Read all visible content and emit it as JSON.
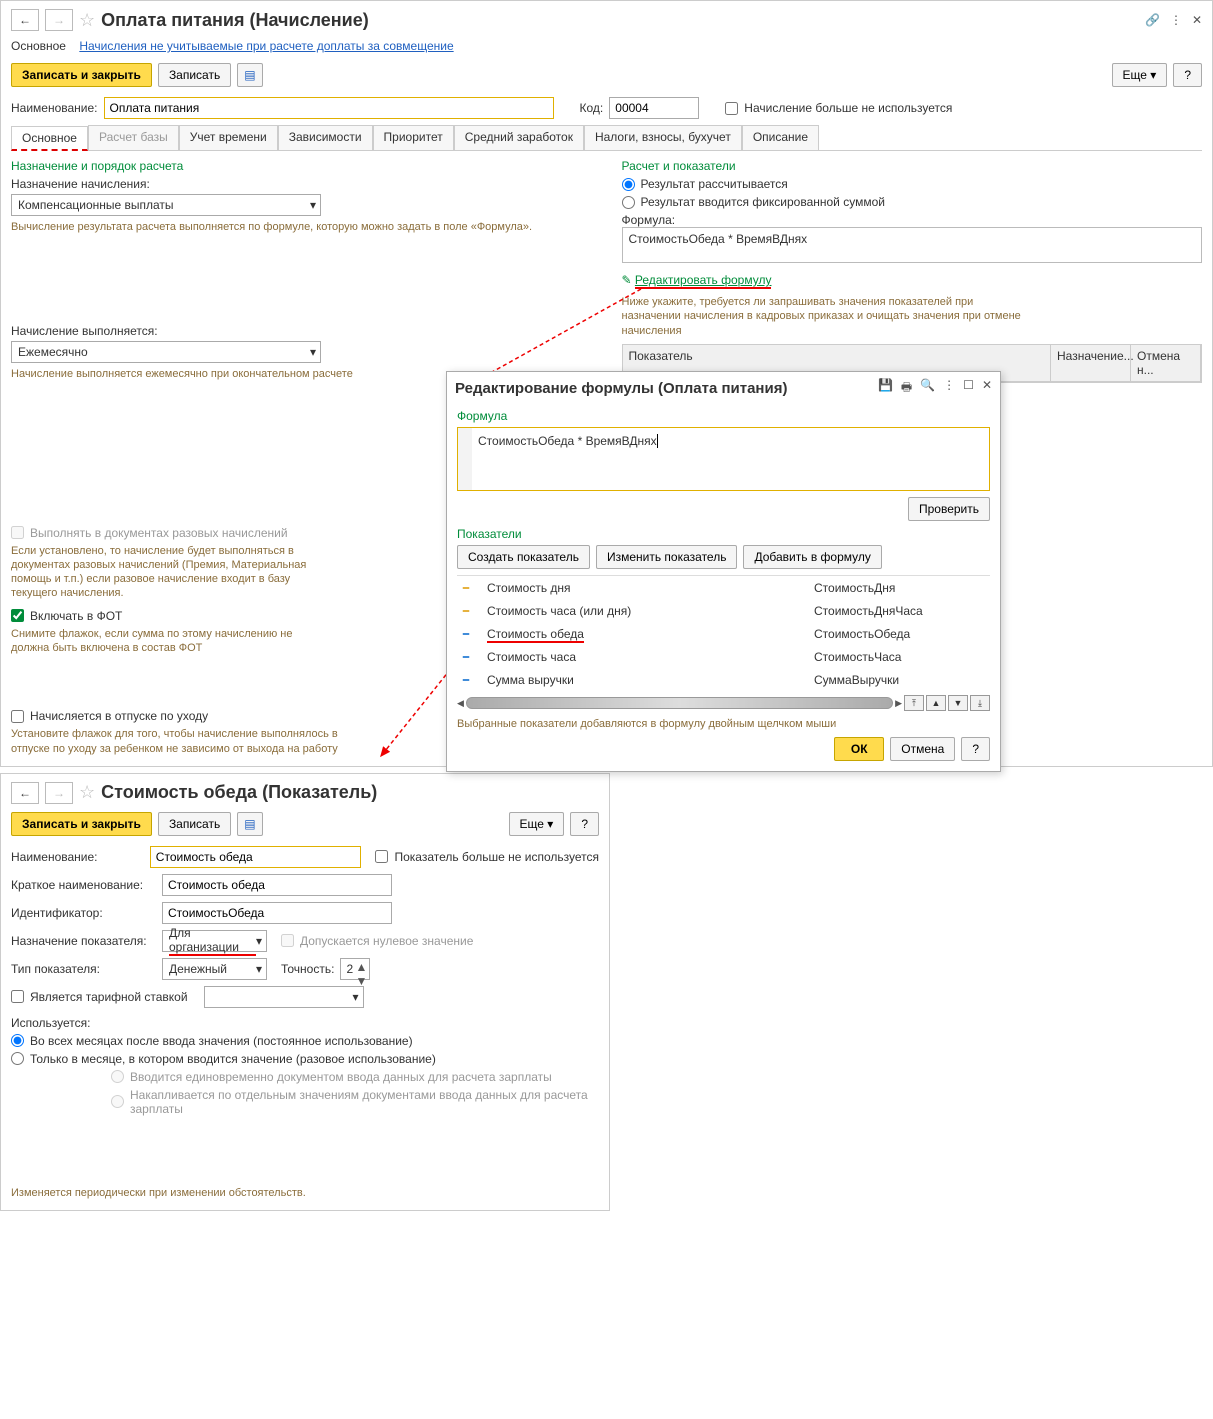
{
  "accrual": {
    "title": "Оплата питания (Начисление)",
    "nav_main": "Основное",
    "nav_link": "Начисления не учитываемые при расчете доплаты за совмещение",
    "btn_save_close": "Записать и закрыть",
    "btn_save": "Записать",
    "btn_more": "Еще",
    "name_label": "Наименование:",
    "name_value": "Оплата питания",
    "code_label": "Код:",
    "code_value": "00004",
    "not_used_label": "Начисление больше не используется",
    "tabs": [
      "Основное",
      "Расчет базы",
      "Учет времени",
      "Зависимости",
      "Приоритет",
      "Средний заработок",
      "Налоги, взносы, бухучет",
      "Описание"
    ],
    "left": {
      "sec1": "Назначение и порядок расчета",
      "purpose_label": "Назначение начисления:",
      "purpose_value": "Компенсационные выплаты",
      "hint_formula": "Вычисление результата расчета выполняется по формуле, которую можно задать в поле «Формула».",
      "exec_label": "Начисление выполняется:",
      "exec_value": "Ежемесячно",
      "hint_monthly": "Начисление выполняется ежемесячно при окончательном расчете",
      "once_check": "Выполнять в документах разовых начислений",
      "hint_once": "Если установлено, то начисление будет выполняться в документах разовых начислений (Премия, Материальная помощь и т.п.) если разовое начисление входит в базу текущего начисления.",
      "fot_check": "Включать в ФОТ",
      "hint_fot": "Снимите флажок, если сумма по этому начислению не должна быть включена в состав ФОТ",
      "leave_check": "Начисляется в отпуске по уходу",
      "hint_leave": "Установите флажок для того, чтобы начисление выполнялось в отпуске по уходу за ребенком не зависимо от выхода на работу"
    },
    "right": {
      "sec1": "Расчет и показатели",
      "r1": "Результат рассчитывается",
      "r2": "Результат вводится фиксированной суммой",
      "formula_label": "Формула:",
      "formula_value": "СтоимостьОбеда * ВремяВДнях",
      "edit_link": "Редактировать формулу",
      "hint_below": "Ниже укажите, требуется ли запрашивать значения показателей при назначении начисления в кадровых приказах и очищать значения при отмене начисления",
      "th1": "Показатель",
      "th2": "Назначение...",
      "th3": "Отмена н..."
    }
  },
  "editor": {
    "title": "Редактирование формулы (Оплата питания)",
    "sec_formula": "Формула",
    "formula_text": "СтоимостьОбеда * ВремяВДнях",
    "btn_check": "Проверить",
    "sec_indicators": "Показатели",
    "btn_create": "Создать показатель",
    "btn_edit": "Изменить показатель",
    "btn_add": "Добавить в формулу",
    "rows": [
      {
        "n": "Стоимость дня",
        "id": "СтоимостьДня"
      },
      {
        "n": "Стоимость часа (или дня)",
        "id": "СтоимостьДняЧаса"
      },
      {
        "n": "Стоимость обеда",
        "id": "СтоимостьОбеда"
      },
      {
        "n": "Стоимость часа",
        "id": "СтоимостьЧаса"
      },
      {
        "n": "Сумма выручки",
        "id": "СуммаВыручки"
      }
    ],
    "hint": "Выбранные показатели добавляются в формулу двойным щелчком мыши",
    "ok": "ОК",
    "cancel": "Отмена"
  },
  "indicator": {
    "title": "Стоимость обеда (Показатель)",
    "btn_save_close": "Записать и закрыть",
    "btn_save": "Записать",
    "btn_more": "Еще",
    "name_label": "Наименование:",
    "name_value": "Стоимость обеда",
    "not_used": "Показатель больше не используется",
    "short_label": "Краткое наименование:",
    "short_value": "Стоимость обеда",
    "ident_label": "Идентификатор:",
    "ident_value": "СтоимостьОбеда",
    "purpose_label": "Назначение показателя:",
    "purpose_value": "Для организации",
    "zero_label": "Допускается нулевое значение",
    "type_label": "Тип показателя:",
    "type_value": "Денежный",
    "precision_label": "Точность:",
    "precision_value": "2",
    "tariff_label": "Является тарифной ставкой",
    "usage_label": "Используется:",
    "u1": "Во всех месяцах после ввода значения (постоянное использование)",
    "u2": "Только в месяце, в котором вводится значение (разовое использование)",
    "u3": "Вводится единовременно документом ввода данных для расчета зарплаты",
    "u4": "Накапливается по отдельным значениям документами ввода данных для расчета зарплаты",
    "footer_hint": "Изменяется периодически при изменении обстоятельств."
  }
}
